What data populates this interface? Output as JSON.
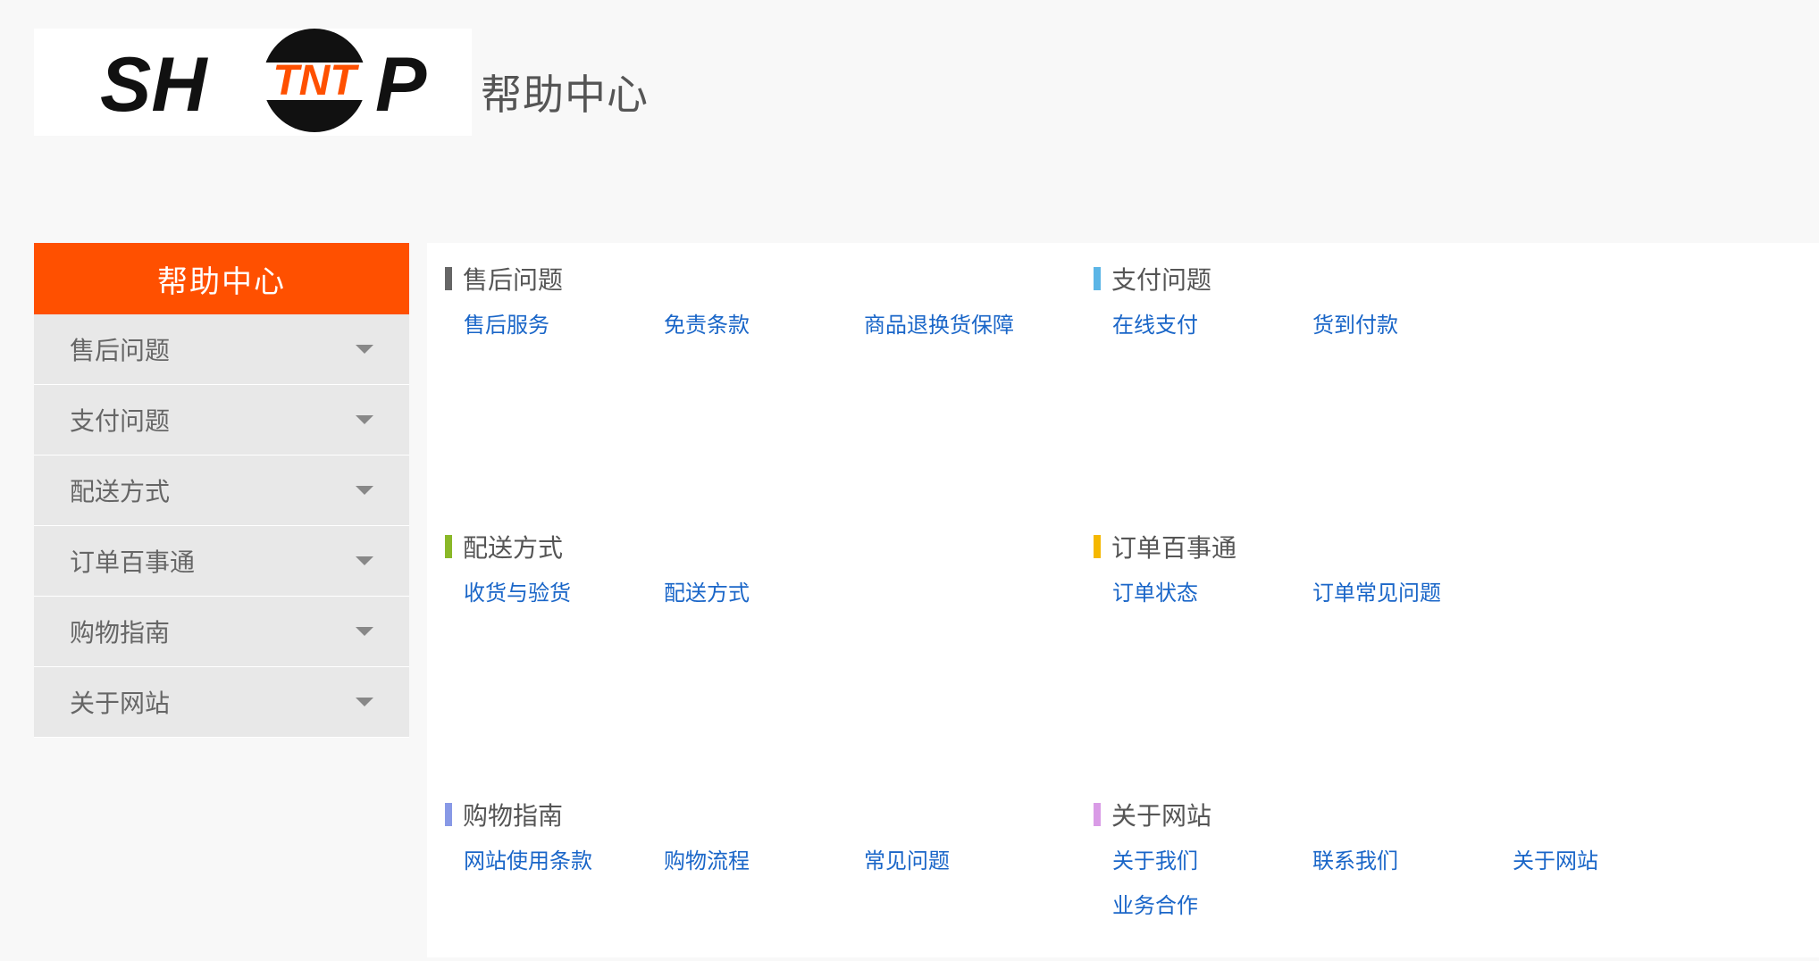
{
  "header": {
    "logo_text": "SHTNTP",
    "title": "帮助中心"
  },
  "sidebar": {
    "title": "帮助中心",
    "items": [
      {
        "label": "售后问题"
      },
      {
        "label": "支付问题"
      },
      {
        "label": "配送方式"
      },
      {
        "label": "订单百事通"
      },
      {
        "label": "购物指南"
      },
      {
        "label": "关于网站"
      }
    ]
  },
  "sections": [
    {
      "title": "售后问题",
      "color": "#666666",
      "links": [
        "售后服务",
        "免责条款",
        "商品退换货保障"
      ]
    },
    {
      "title": "支付问题",
      "color": "#5bb5e6",
      "links": [
        "在线支付",
        "货到付款"
      ]
    },
    {
      "title": "配送方式",
      "color": "#8ab828",
      "links": [
        "收货与验货",
        "配送方式"
      ]
    },
    {
      "title": "订单百事通",
      "color": "#f5b800",
      "links": [
        "订单状态",
        "订单常见问题"
      ]
    },
    {
      "title": "购物指南",
      "color": "#8899e6",
      "links": [
        "网站使用条款",
        "购物流程",
        "常见问题"
      ]
    },
    {
      "title": "关于网站",
      "color": "#d99be6",
      "links": [
        "关于我们",
        "联系我们",
        "关于网站",
        "业务合作"
      ]
    }
  ]
}
